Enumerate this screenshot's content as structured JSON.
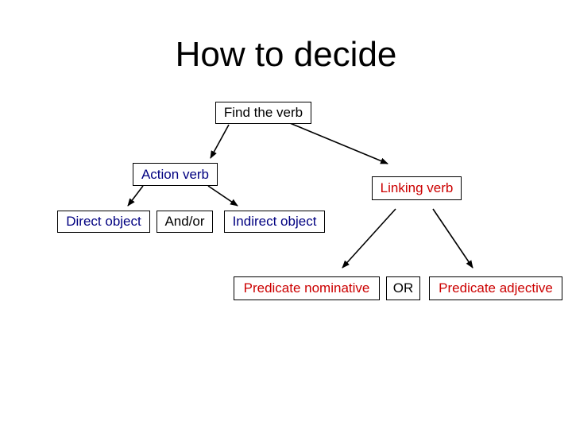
{
  "title": "How to decide",
  "colors": {
    "black": "#000000",
    "navy": "#000080",
    "red": "#cc0000"
  },
  "nodes": {
    "find_verb": {
      "label": "Find the verb",
      "color": "#000000"
    },
    "action_verb": {
      "label": "Action verb",
      "color": "#000080"
    },
    "linking_verb": {
      "label": "Linking verb",
      "color": "#cc0000"
    },
    "direct_object": {
      "label": "Direct object",
      "color": "#000080"
    },
    "and_or": {
      "label": "And/or",
      "color": "#000000"
    },
    "indirect_object": {
      "label": "Indirect object",
      "color": "#000080"
    },
    "predicate_nominative": {
      "label": "Predicate nominative",
      "color": "#cc0000"
    },
    "or": {
      "label": "OR",
      "color": "#000000"
    },
    "predicate_adjective": {
      "label": "Predicate adjective",
      "color": "#cc0000"
    }
  },
  "edges": [
    {
      "from": "find_verb",
      "to": "action_verb"
    },
    {
      "from": "find_verb",
      "to": "linking_verb"
    },
    {
      "from": "action_verb",
      "to": "direct_object"
    },
    {
      "from": "action_verb",
      "to": "indirect_object"
    },
    {
      "from": "linking_verb",
      "to": "predicate_nominative"
    },
    {
      "from": "linking_verb",
      "to": "predicate_adjective"
    }
  ]
}
